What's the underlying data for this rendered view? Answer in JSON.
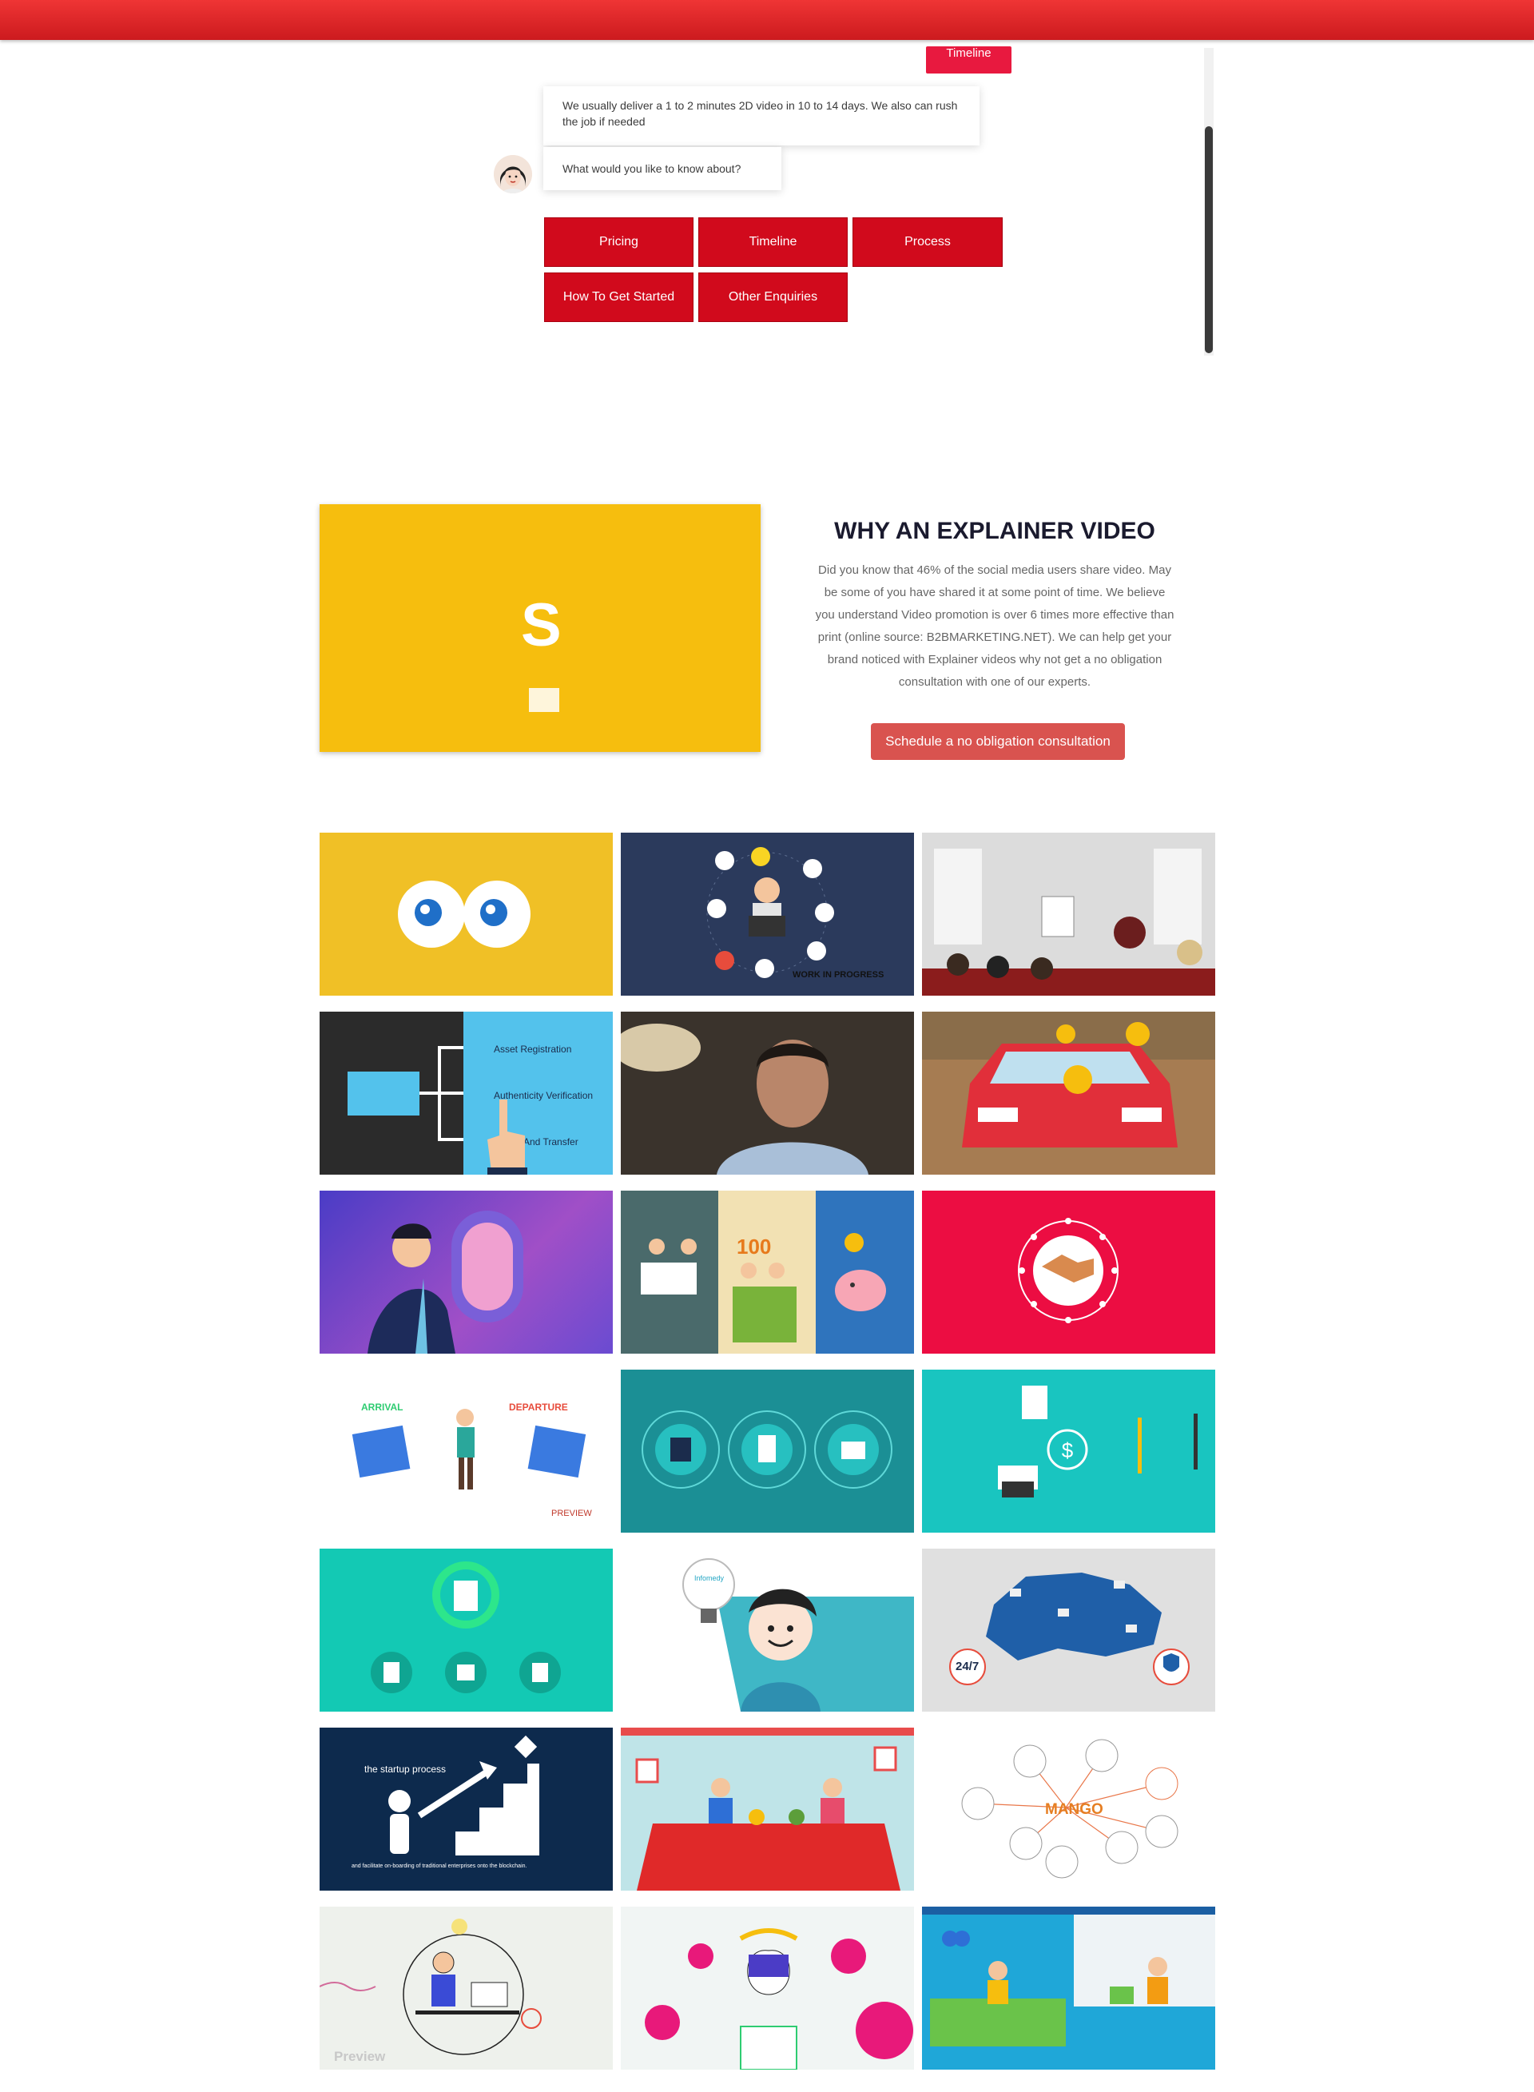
{
  "chat": {
    "prev_option": "Timeline",
    "bot_reply": "We usually deliver a 1 to 2 minutes 2D video in 10 to 14 days. We also can rush the job if needed",
    "bot_question": "What would you like to know about?",
    "options": [
      "Pricing",
      "Timeline",
      "Process",
      "How To Get Started",
      "Other Enquiries"
    ]
  },
  "why": {
    "video_letter": "S",
    "title": "WHY AN EXPLAINER VIDEO",
    "text": "Did you know that 46% of the social media users share video. May be some of you have shared it at some point of time. We believe you understand Video promotion is over 6 times more effective than print (online source: B2BMARKETING.NET). We can help get your brand noticed with Explainer videos why not get a no obligation consultation with one of our experts.",
    "cta": "Schedule a no obligation consultation"
  },
  "gallery": {
    "labels": {
      "work_in_progress": "WORK IN PROGRESS",
      "asset_registration": "Asset Registration",
      "authenticity": "Authenticity Verification",
      "and_transfer": "And Transfer",
      "arrival": "ARRIVAL",
      "departure": "DEPARTURE",
      "preview": "PREVIEW",
      "startup": "the startup process",
      "startup_sub": "and facilitate on-boarding of traditional enterprises onto  the blockchain.",
      "mango": "MANGO",
      "preview2": "Preview",
      "hours": "24/7",
      "hundred": "100",
      "bulb": "Infomedy"
    }
  },
  "colors": {
    "brand_red": "#d10a1c",
    "top_bar": "#e22b2b",
    "cta": "#d9534f",
    "yellow": "#f6be0e"
  }
}
